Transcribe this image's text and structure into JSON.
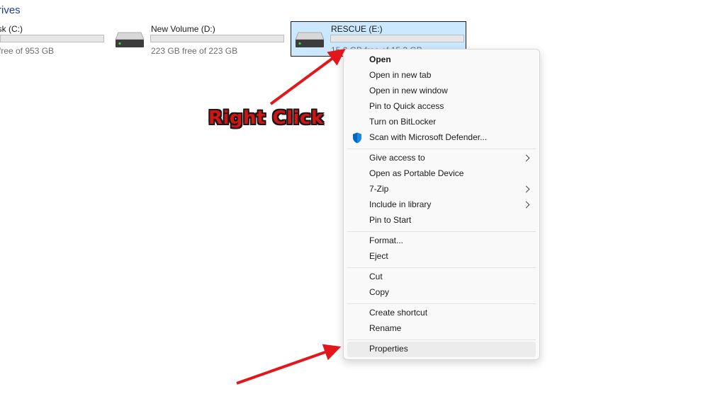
{
  "section": {
    "title": "rives"
  },
  "drives": [
    {
      "name": "isk (C:)",
      "free": "free of 953 GB"
    },
    {
      "name": "New Volume (D:)",
      "free": "223 GB free of 223 GB"
    },
    {
      "name": "RESCUE (E:)",
      "free": "15.2 GB free of 15.3 GB"
    }
  ],
  "menu": {
    "items": [
      {
        "label": "Open"
      },
      {
        "label": "Open in new tab"
      },
      {
        "label": "Open in new window"
      },
      {
        "label": "Pin to Quick access"
      },
      {
        "label": "Turn on BitLocker"
      },
      {
        "label": "Scan with Microsoft Defender..."
      },
      {
        "label": "Give access to"
      },
      {
        "label": "Open as Portable Device"
      },
      {
        "label": "7-Zip"
      },
      {
        "label": "Include in library"
      },
      {
        "label": "Pin to Start"
      },
      {
        "label": "Format..."
      },
      {
        "label": "Eject"
      },
      {
        "label": "Cut"
      },
      {
        "label": "Copy"
      },
      {
        "label": "Create shortcut"
      },
      {
        "label": "Rename"
      },
      {
        "label": "Properties"
      }
    ]
  },
  "annotation": {
    "text": "Right Click"
  },
  "colors": {
    "selection": "#cce8ff",
    "arrow": "#e3161b",
    "defender_shield": "#0067c0"
  }
}
